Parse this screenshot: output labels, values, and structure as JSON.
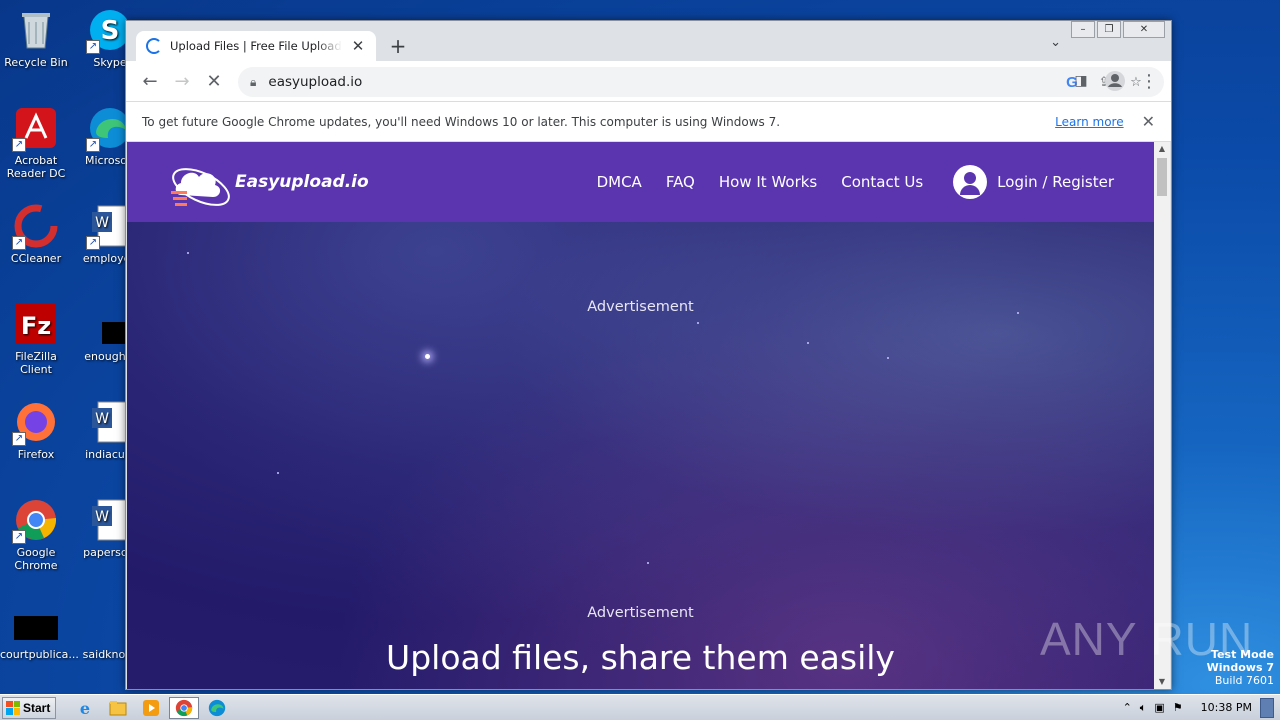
{
  "desktop": {
    "icons": [
      {
        "label": "Recycle Bin",
        "icon": "recycle-bin-icon"
      },
      {
        "label": "Skype",
        "icon": "skype-icon"
      },
      {
        "label": "Acrobat Reader DC",
        "icon": "acrobat-icon"
      },
      {
        "label": "Microsoft",
        "icon": "edge-icon"
      },
      {
        "label": "CCleaner",
        "icon": "ccleaner-icon"
      },
      {
        "label": "employee",
        "icon": "word-doc-icon"
      },
      {
        "label": "FileZilla Client",
        "icon": "filezilla-icon"
      },
      {
        "label": "enoughst",
        "icon": "file-icon"
      },
      {
        "label": "Firefox",
        "icon": "firefox-icon"
      },
      {
        "label": "indiacust",
        "icon": "word-doc-icon"
      },
      {
        "label": "Google Chrome",
        "icon": "chrome-icon"
      },
      {
        "label": "papersclu",
        "icon": "word-doc-icon"
      },
      {
        "label": "courtpublica...",
        "icon": "file-icon"
      },
      {
        "label": "saidknowl",
        "icon": "file-icon"
      }
    ]
  },
  "browser": {
    "tab_title": "Upload Files | Free File Upload and Transfer",
    "url": "easyupload.io",
    "infobar_message": "To get future Google Chrome updates, you'll need Windows 10 or later. This computer is using Windows 7.",
    "infobar_link": "Learn more"
  },
  "site": {
    "brand": "Easyupload.io",
    "nav": [
      "DMCA",
      "FAQ",
      "How It Works",
      "Contact Us"
    ],
    "login": "Login / Register",
    "ad_label": "Advertisement",
    "hero": "Upload files, share them easily",
    "brand_color": "#5b35b0"
  },
  "watermark": "ANY RUN",
  "testmode": {
    "line1": "Test Mode",
    "line2": "Windows 7",
    "line3": "Build 7601"
  },
  "taskbar": {
    "start": "Start",
    "clock": "10:38 PM"
  }
}
